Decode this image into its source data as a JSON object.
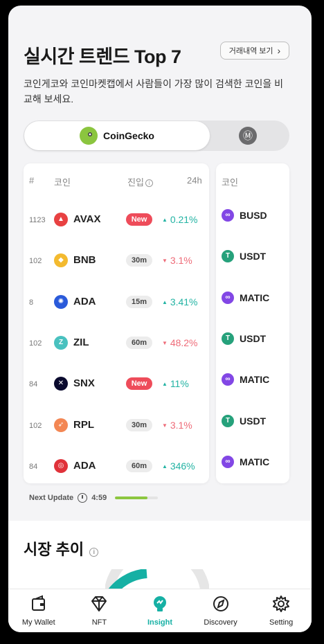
{
  "header": {
    "title": "실시간 트렌드 Top 7",
    "history_button": "거래내역 보기",
    "description": "코인게코와 코인마켓캡에서 사람들이 가장 많이 검색한 코인을 비교해 보세요."
  },
  "toggle": {
    "active_label": "CoinGecko",
    "inactive_icon": "coinmarketcap-icon"
  },
  "table": {
    "headers": {
      "rank": "#",
      "coin": "코인",
      "entry": "진입",
      "change": "24h"
    },
    "rows": [
      {
        "rank": "1123",
        "symbol": "AVAX",
        "icon": "avalanche-icon",
        "color": "#e84142",
        "badge": "New",
        "badge_type": "new",
        "change": "0.21%",
        "direction": "up"
      },
      {
        "rank": "102",
        "symbol": "BNB",
        "icon": "bnb-icon",
        "color": "#f3ba2f",
        "badge": "30m",
        "badge_type": "time",
        "change": "3.1%",
        "direction": "down"
      },
      {
        "rank": "8",
        "symbol": "ADA",
        "icon": "cardano-icon",
        "color": "#2a5ada",
        "badge": "15m",
        "badge_type": "time",
        "change": "3.41%",
        "direction": "up"
      },
      {
        "rank": "102",
        "symbol": "ZIL",
        "icon": "zilliqa-icon",
        "color": "#49c1bf",
        "badge": "60m",
        "badge_type": "time",
        "change": "48.2%",
        "direction": "down"
      },
      {
        "rank": "84",
        "symbol": "SNX",
        "icon": "synthetix-icon",
        "color": "#0a0a2e",
        "badge": "New",
        "badge_type": "new",
        "change": "11%",
        "direction": "up"
      },
      {
        "rank": "102",
        "symbol": "RPL",
        "icon": "rocketpool-icon",
        "color": "#f38754",
        "badge": "30m",
        "badge_type": "time",
        "change": "3.1%",
        "direction": "down"
      },
      {
        "rank": "84",
        "symbol": "ADA",
        "icon": "cardano-red-icon",
        "color": "#e0323a",
        "badge": "60m",
        "badge_type": "time",
        "change": "346%",
        "direction": "up"
      }
    ]
  },
  "side_table": {
    "header": "코인",
    "rows": [
      {
        "symbol": "BUSD",
        "icon": "polygon-icon",
        "color": "#8247e5"
      },
      {
        "symbol": "USDT",
        "icon": "tether-icon",
        "color": "#26a17b"
      },
      {
        "symbol": "MATIC",
        "icon": "polygon-icon",
        "color": "#8247e5"
      },
      {
        "symbol": "USDT",
        "icon": "tether-icon",
        "color": "#26a17b"
      },
      {
        "symbol": "MATIC",
        "icon": "polygon-icon",
        "color": "#8247e5"
      },
      {
        "symbol": "USDT",
        "icon": "tether-icon",
        "color": "#26a17b"
      },
      {
        "symbol": "MATIC",
        "icon": "polygon-icon",
        "color": "#8247e5"
      }
    ]
  },
  "update": {
    "label": "Next Update",
    "time": "4:59",
    "progress": 0.75
  },
  "market": {
    "title": "시장 추이"
  },
  "tabs": [
    {
      "label": "My Wallet",
      "icon": "wallet-icon",
      "active": false
    },
    {
      "label": "NFT",
      "icon": "diamond-icon",
      "active": false
    },
    {
      "label": "Insight",
      "icon": "lightbulb-icon",
      "active": true
    },
    {
      "label": "Discovery",
      "icon": "compass-icon",
      "active": false
    },
    {
      "label": "Setting",
      "icon": "gear-icon",
      "active": false
    }
  ],
  "colors": {
    "accent": "#16b0a4",
    "up": "#22b3a3",
    "down": "#ee6b78",
    "new_badge": "#ee4c5a"
  }
}
